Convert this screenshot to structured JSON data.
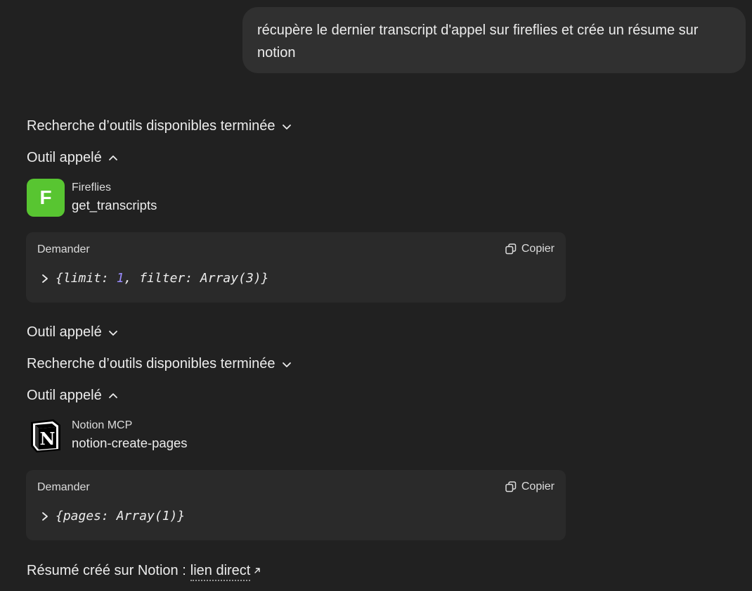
{
  "user_message": "récupère le dernier transcript d'appel sur fireflies et crée un résume sur notion",
  "steps": {
    "search1": "Recherche d’outils disponibles terminée",
    "tool1": "Outil appelé",
    "tool2": "Outil appelé",
    "search2": "Recherche d’outils disponibles terminée",
    "tool3": "Outil appelé"
  },
  "tool_calls": [
    {
      "app": "Fireflies",
      "icon_letter": "F",
      "icon_color": "#58c531",
      "function": "get_transcripts",
      "request_label": "Demander",
      "copy_label": "Copier",
      "code_open": "{limit: ",
      "code_num": "1",
      "code_close": ", filter: Array(3)}"
    },
    {
      "app": "Notion MCP",
      "icon_letter": "N",
      "function": "notion-create-pages",
      "request_label": "Demander",
      "copy_label": "Copier",
      "code": "{pages: Array(1)}"
    }
  ],
  "final": {
    "text": "Résumé créé sur Notion :",
    "link_label": "lien direct"
  },
  "colors": {
    "background": "#212121",
    "bubble": "#303030",
    "box": "#2a2a2a",
    "number": "#9b8cff"
  }
}
